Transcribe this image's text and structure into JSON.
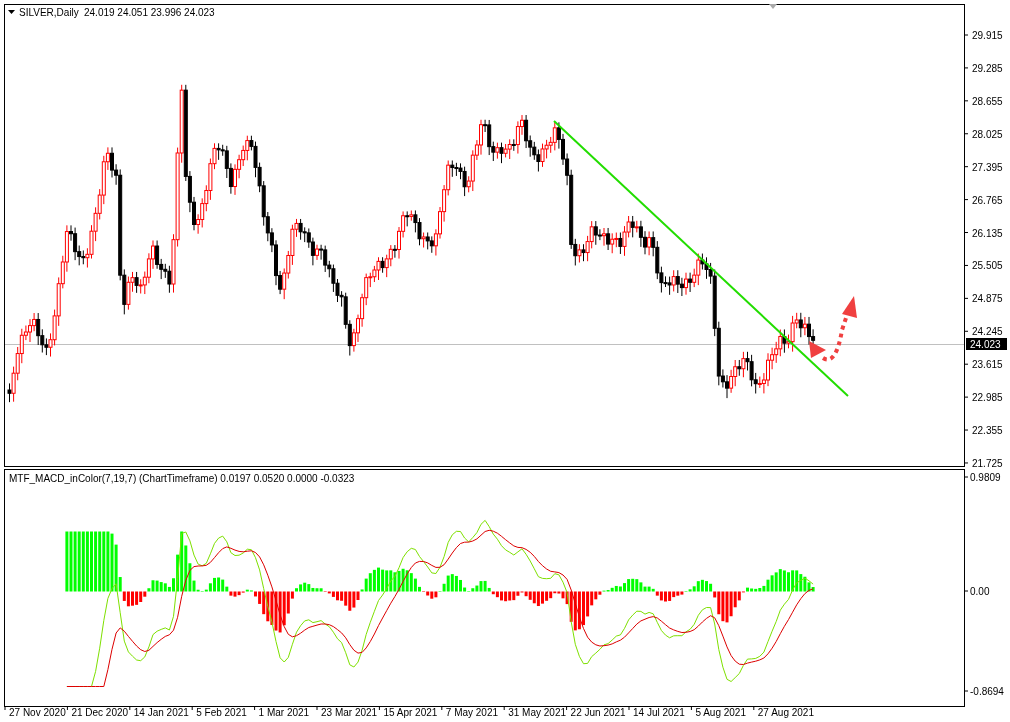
{
  "header": {
    "symbol": "SILVER,Daily",
    "ohlc": "24.019 24.051 23.996 24.023"
  },
  "price_axis": [
    "29.915",
    "29.285",
    "28.655",
    "28.025",
    "27.395",
    "26.765",
    "26.135",
    "25.505",
    "24.875",
    "24.245",
    "23.615",
    "22.985",
    "22.355",
    "21.725"
  ],
  "current_price": "24.023",
  "indicator": {
    "title": "MTF_MACD_inColor(7,19,7) (ChartTimeframe) 0.0197 0.0520 0.0000 -0.0323",
    "axis": [
      "0.9809",
      "0.00",
      "-0.8694"
    ]
  },
  "date_axis": [
    "27 Nov 2020",
    "21 Dec 2020",
    "14 Jan 2021",
    "5 Feb 2021",
    "1 Mar 2021",
    "23 Mar 2021",
    "15 Apr 2021",
    "7 May 2021",
    "31 May 2021",
    "22 Jun 2021",
    "14 Jul 2021",
    "5 Aug 2021",
    "27 Aug 2021"
  ]
}
